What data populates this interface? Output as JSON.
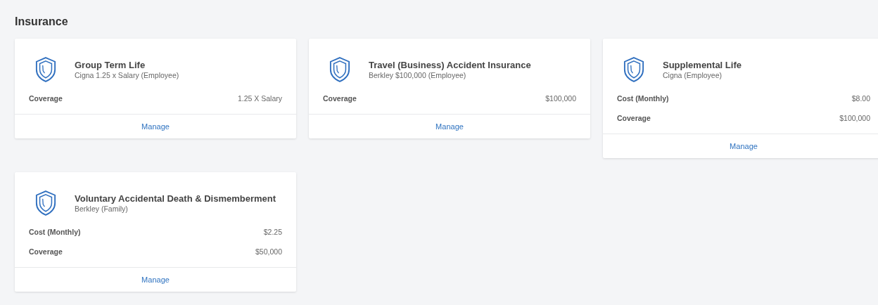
{
  "section": {
    "title": "Insurance"
  },
  "cards": [
    {
      "title": "Group Term Life",
      "subtitle": "Cigna 1.25 x Salary (Employee)",
      "rows": [
        {
          "label": "Coverage",
          "value": "1.25 X Salary"
        }
      ],
      "action": "Manage"
    },
    {
      "title": "Travel (Business) Accident Insurance",
      "subtitle": "Berkley $100,000 (Employee)",
      "rows": [
        {
          "label": "Coverage",
          "value": "$100,000"
        }
      ],
      "action": "Manage"
    },
    {
      "title": "Supplemental Life",
      "subtitle": "Cigna (Employee)",
      "rows": [
        {
          "label": "Cost (Monthly)",
          "value": "$8.00"
        },
        {
          "label": "Coverage",
          "value": "$100,000"
        }
      ],
      "action": "Manage"
    },
    {
      "title": "Voluntary Accidental Death & Dismemberment",
      "subtitle": "Berkley (Family)",
      "rows": [
        {
          "label": "Cost (Monthly)",
          "value": "$2.25"
        },
        {
          "label": "Coverage",
          "value": "$50,000"
        }
      ],
      "action": "Manage"
    }
  ]
}
